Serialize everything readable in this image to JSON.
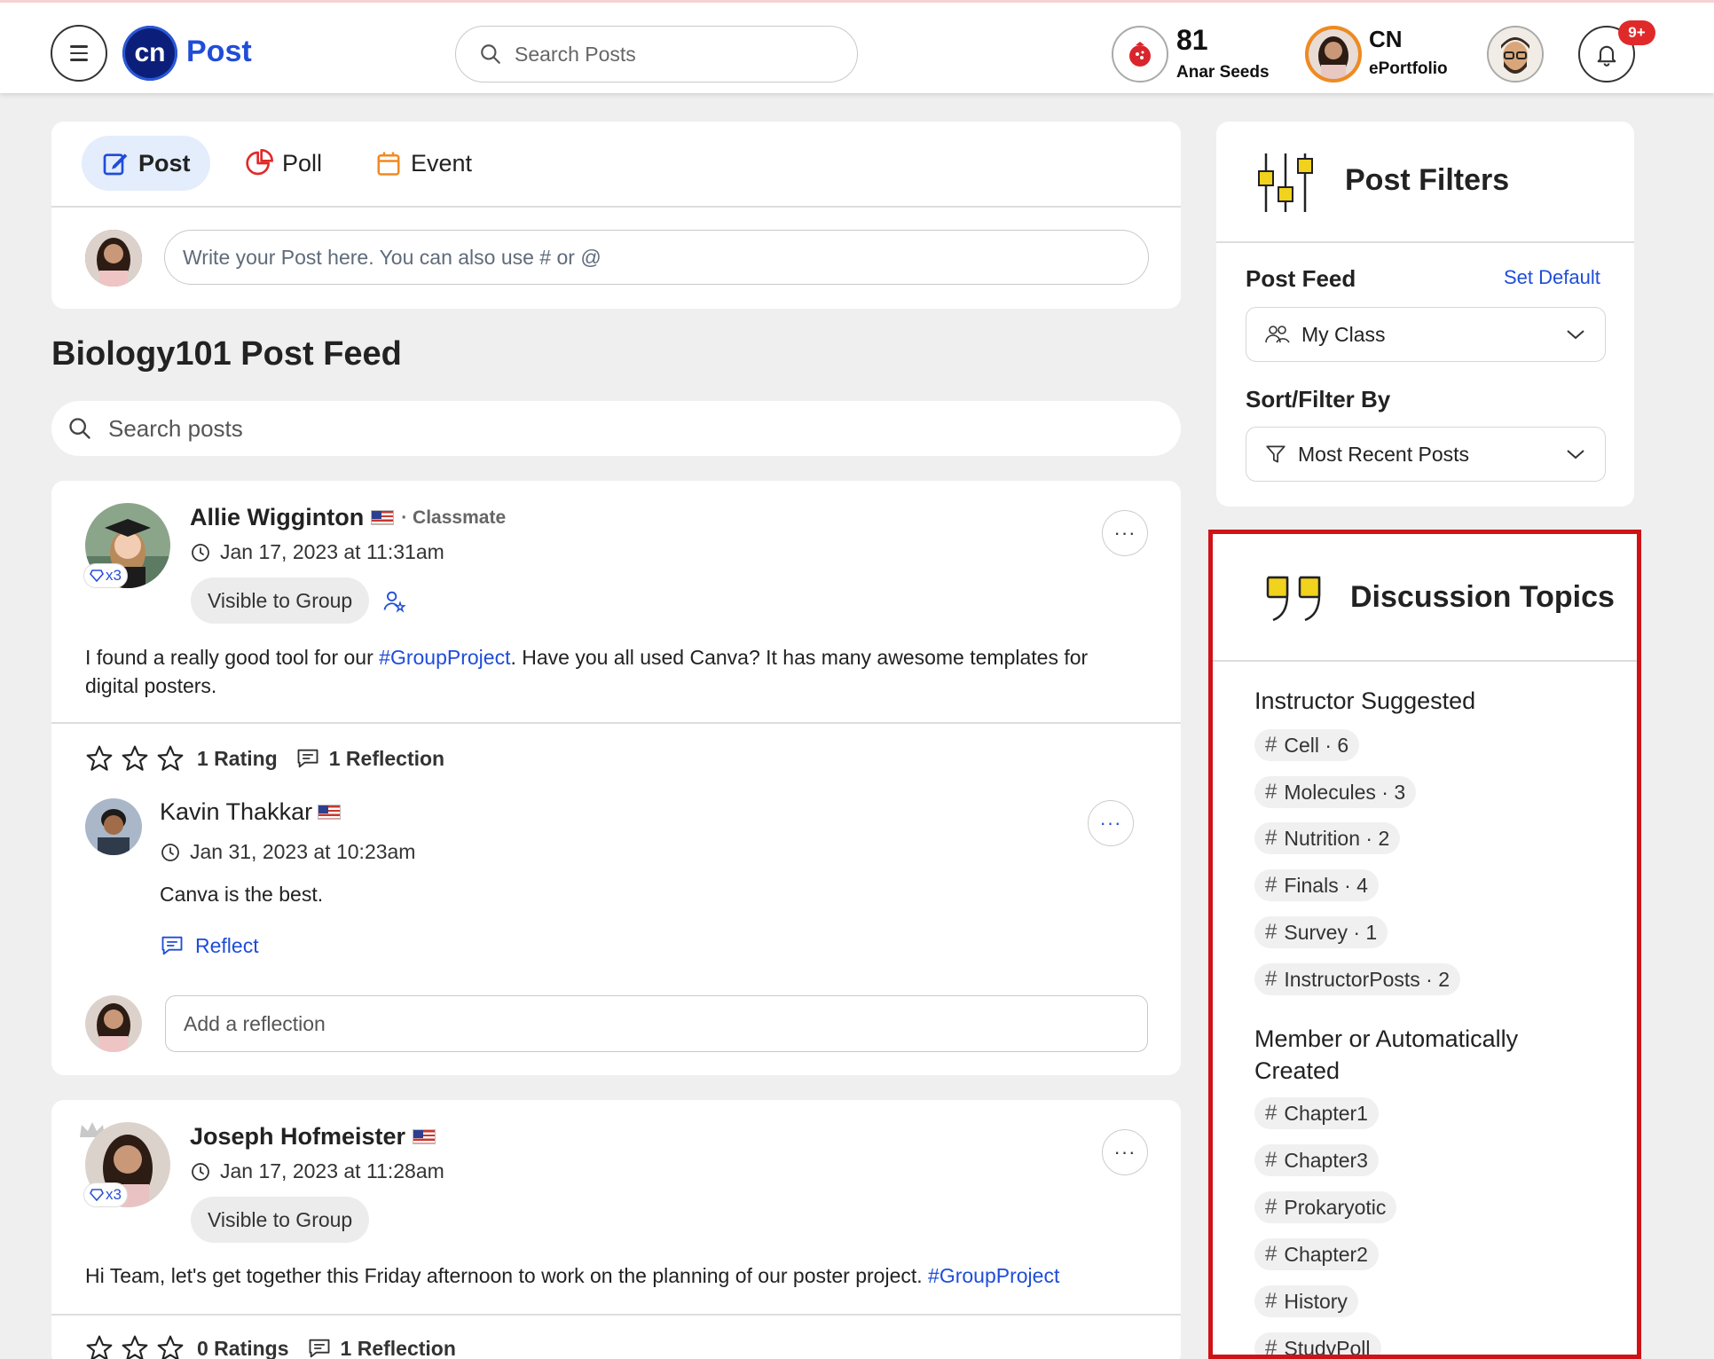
{
  "header": {
    "brand": "Post",
    "logo_text": "cn",
    "search_placeholder": "Search Posts",
    "seeds_count": "81",
    "seeds_label": "Anar Seeds",
    "cn_title": "CN",
    "cn_sub": "ePortfolio",
    "notifications": "9+"
  },
  "composer": {
    "tabs": [
      {
        "label": "Post",
        "icon": "edit-icon",
        "color": "#1f4dd8"
      },
      {
        "label": "Poll",
        "icon": "pie-chart-icon",
        "color": "#e02a2a"
      },
      {
        "label": "Event",
        "icon": "calendar-icon",
        "color": "#f08a1f"
      }
    ],
    "placeholder": "Write your Post here. You can also use # or @"
  },
  "feed": {
    "title": "Biology101 Post Feed",
    "search_placeholder": "Search posts"
  },
  "posts": [
    {
      "author": "Allie Wigginton",
      "role": "· Classmate",
      "date": "Jan 17, 2023 at 11:31am",
      "badge": "x3",
      "visibility": "Visible to Group",
      "text_before": "I found a really good tool for our ",
      "tag": "#GroupProject",
      "text_after": ". Have you all used Canva? It has many awesome templates for digital posters.",
      "rating_label": "1 Rating",
      "reflection_label": "1 Reflection",
      "reflection": {
        "author": "Kavin Thakkar",
        "date": "Jan 31, 2023 at 10:23am",
        "text": "Canva is the best.",
        "reflect_label": "Reflect"
      },
      "reflection_placeholder": "Add a reflection"
    },
    {
      "author": "Joseph Hofmeister",
      "date": "Jan 17, 2023 at 11:28am",
      "badge": "x3",
      "visibility": "Visible to Group",
      "text_before": "Hi Team, let's get together this Friday afternoon to work on the planning of our poster project. ",
      "tag": "#GroupProject",
      "rating_label": "0 Ratings",
      "reflection_label": "1 Reflection"
    }
  ],
  "filters": {
    "title": "Post Filters",
    "post_feed_label": "Post Feed",
    "set_default": "Set Default",
    "post_feed_value": "My Class",
    "sort_label": "Sort/Filter By",
    "sort_value": "Most Recent Posts"
  },
  "topics": {
    "title": "Discussion Topics",
    "instructor_label": "Instructor Suggested",
    "instructor_topics": [
      {
        "name": "Cell",
        "count": "· 6"
      },
      {
        "name": "Molecules",
        "count": "· 3"
      },
      {
        "name": "Nutrition",
        "count": "· 2"
      },
      {
        "name": "Finals",
        "count": "· 4"
      },
      {
        "name": "Survey",
        "count": "· 1"
      },
      {
        "name": "InstructorPosts",
        "count": "· 2"
      }
    ],
    "member_label": "Member or Automatically Created",
    "member_topics": [
      "Chapter1",
      "Chapter3",
      "Prokaryotic",
      "Chapter2",
      "History",
      "StudyPoll"
    ]
  },
  "colors": {
    "accent": "#1f4dd8",
    "highlight_border": "#cf1218",
    "notification_badge": "#e02a2a"
  }
}
